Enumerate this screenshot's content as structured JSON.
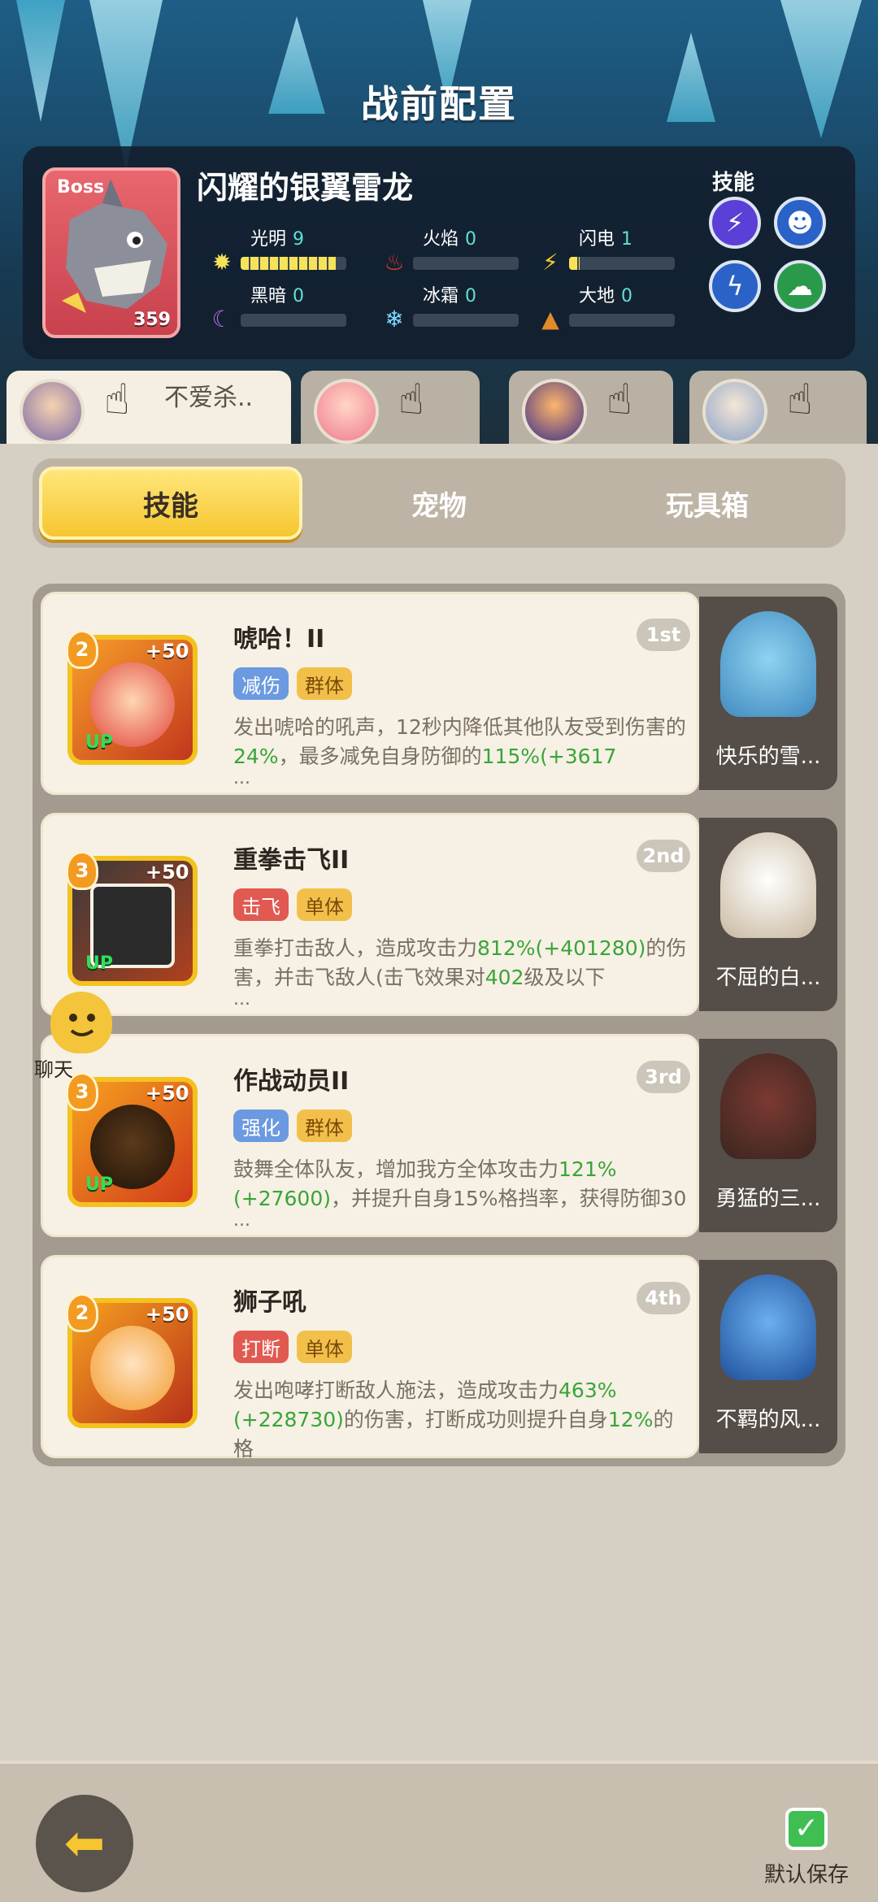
{
  "page_title": "战前配置",
  "boss": {
    "tag": "Boss",
    "name": "闪耀的银翼雷龙",
    "level": "359",
    "skills_label": "技能",
    "elements": [
      {
        "label": "光明",
        "value": "9",
        "icon": "sun-icon"
      },
      {
        "label": "火焰",
        "value": "0",
        "icon": "fire-icon"
      },
      {
        "label": "闪电",
        "value": "1",
        "icon": "lightning-icon"
      },
      {
        "label": "黑暗",
        "value": "0",
        "icon": "moon-icon"
      },
      {
        "label": "冰霜",
        "value": "0",
        "icon": "snowflake-icon"
      },
      {
        "label": "大地",
        "value": "0",
        "icon": "earth-icon"
      }
    ]
  },
  "team": {
    "active_name": "不爱杀.."
  },
  "segments": [
    "技能",
    "宠物",
    "玩具箱"
  ],
  "skills": [
    {
      "rank": "1st",
      "name": "唬哈！II",
      "level": "2",
      "plus": "+50",
      "up": "UP",
      "tags": [
        "减伤",
        "群体"
      ],
      "desc_parts": [
        "发出唬哈的吼声，12秒内降低其他队友受到伤害的",
        "24%",
        "，最多减免自身防御的",
        "115%(+3617"
      ],
      "more": "...",
      "pet": "快乐的雪..."
    },
    {
      "rank": "2nd",
      "name": "重拳击飞II",
      "level": "3",
      "plus": "+50",
      "up": "UP",
      "tags": [
        "击飞",
        "单体"
      ],
      "desc_parts": [
        "重拳打击敌人，造成攻击力",
        "812%(+401280)",
        "的伤害，并击飞敌人(击飞效果对",
        "402",
        "级及以下"
      ],
      "more": "...",
      "pet": "不屈的白..."
    },
    {
      "rank": "3rd",
      "name": "作战动员II",
      "level": "3",
      "plus": "+50",
      "up": "UP",
      "tags": [
        "强化",
        "群体"
      ],
      "desc_parts": [
        "鼓舞全体队友，增加我方全体攻击力",
        "121%(+27600)",
        "，并提升自身15%格挡率，获得防御30"
      ],
      "more": "...",
      "pet": "勇猛的三..."
    },
    {
      "rank": "4th",
      "name": "狮子吼",
      "level": "2",
      "plus": "+50",
      "up": "",
      "tags": [
        "打断",
        "单体"
      ],
      "desc_parts": [
        "发出咆哮打断敌人施法，造成攻击力",
        "463%(+228730)",
        "的伤害，打断成功则提升自身",
        "12%",
        "的格"
      ],
      "more": "...",
      "pet": "不羁的风..."
    }
  ],
  "chat_label": "聊天",
  "save_label": "默认保存"
}
